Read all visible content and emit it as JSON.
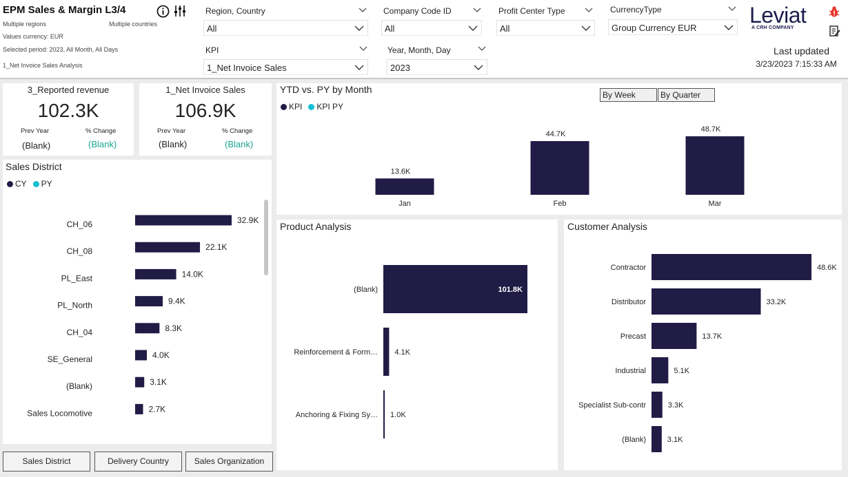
{
  "colors": {
    "kpi_bar": "#211c46",
    "py_dot": "#15c0d6",
    "teal": "#1aa592",
    "brand": "#1d1d4f",
    "alert": "#e8332a"
  },
  "header": {
    "title": "EPM Sales & Margin L3/4",
    "regions": "Multiple regions",
    "countries": "Multiple countries",
    "currency": "Values currency: EUR",
    "period": "Selected period: 2023, All Month, All Days",
    "analysis": "1_Net Invoice Sales Analysis",
    "icons": [
      "info-icon",
      "sliders-icon",
      "bug-icon",
      "notes-icon"
    ]
  },
  "slicers": [
    {
      "label": "Region, Country",
      "value": "All"
    },
    {
      "label": "Company Code ID",
      "value": "All"
    },
    {
      "label": "Profit Center Type",
      "value": "All"
    },
    {
      "label": "CurrencyType",
      "value": "Group Currency EUR"
    },
    {
      "label": "KPI",
      "value": "1_Net Invoice Sales"
    },
    {
      "label": "Year, Month, Day",
      "value": "2023"
    }
  ],
  "logo": {
    "name": "Leviat",
    "sub": "A CRH COMPANY"
  },
  "last_updated": {
    "label": "Last updated",
    "value": "3/23/2023 7:15:33 AM"
  },
  "kpi_cards": [
    {
      "title": "3_Reported revenue",
      "value": "102.3K",
      "prev_label": "Prev Year",
      "prev_value": "(Blank)",
      "change_label": "% Change",
      "change_value": "(Blank)"
    },
    {
      "title": "1_Net Invoice Sales",
      "value": "106.9K",
      "prev_label": "Prev Year",
      "prev_value": "(Blank)",
      "change_label": "% Change",
      "change_value": "(Blank)"
    }
  ],
  "sales_district": {
    "title": "Sales District",
    "legend": [
      "CY",
      "PY"
    ],
    "buttons": [
      "Sales District",
      "Delivery Country",
      "Sales Organization"
    ]
  },
  "ytd": {
    "title": "YTD vs. PY by Month",
    "legend": [
      "KPI",
      "KPI PY"
    ],
    "buttons": [
      "By Week",
      "By Quarter"
    ]
  },
  "product": {
    "title": "Product Analysis"
  },
  "customer": {
    "title": "Customer Analysis"
  },
  "chart_data": [
    {
      "type": "bar",
      "orientation": "horizontal",
      "title": "Sales District",
      "categories": [
        "CH_06",
        "CH_08",
        "PL_East",
        "PL_North",
        "CH_04",
        "SE_General",
        "(Blank)",
        "Sales Locomotive"
      ],
      "values": [
        32.9,
        22.1,
        14.0,
        9.4,
        8.3,
        4.0,
        3.1,
        2.7
      ],
      "labels": [
        "32.9K",
        "22.1K",
        "14.0K",
        "9.4K",
        "8.3K",
        "4.0K",
        "3.1K",
        "2.7K"
      ],
      "series": [
        {
          "name": "CY"
        },
        {
          "name": "PY"
        }
      ]
    },
    {
      "type": "bar",
      "orientation": "vertical",
      "title": "YTD vs. PY by Month",
      "categories": [
        "Jan",
        "Feb",
        "Mar"
      ],
      "values": [
        13.6,
        44.7,
        48.7
      ],
      "labels": [
        "13.6K",
        "44.7K",
        "48.7K"
      ],
      "series": [
        {
          "name": "KPI"
        },
        {
          "name": "KPI PY"
        }
      ]
    },
    {
      "type": "bar",
      "orientation": "horizontal",
      "title": "Product Analysis",
      "categories": [
        "(Blank)",
        "Reinforcement & Form…",
        "Anchoring & Fixing Sy…"
      ],
      "values": [
        101.8,
        4.1,
        1.0
      ],
      "labels": [
        "101.8K",
        "4.1K",
        "1.0K"
      ]
    },
    {
      "type": "bar",
      "orientation": "horizontal",
      "title": "Customer Analysis",
      "categories": [
        "Contractor",
        "Distributor",
        "Precast",
        "Industrial",
        "Specialist Sub-contr",
        "(Blank)"
      ],
      "values": [
        48.6,
        33.2,
        13.7,
        5.1,
        3.3,
        3.1
      ],
      "labels": [
        "48.6K",
        "33.2K",
        "13.7K",
        "5.1K",
        "3.3K",
        "3.1K"
      ]
    }
  ]
}
